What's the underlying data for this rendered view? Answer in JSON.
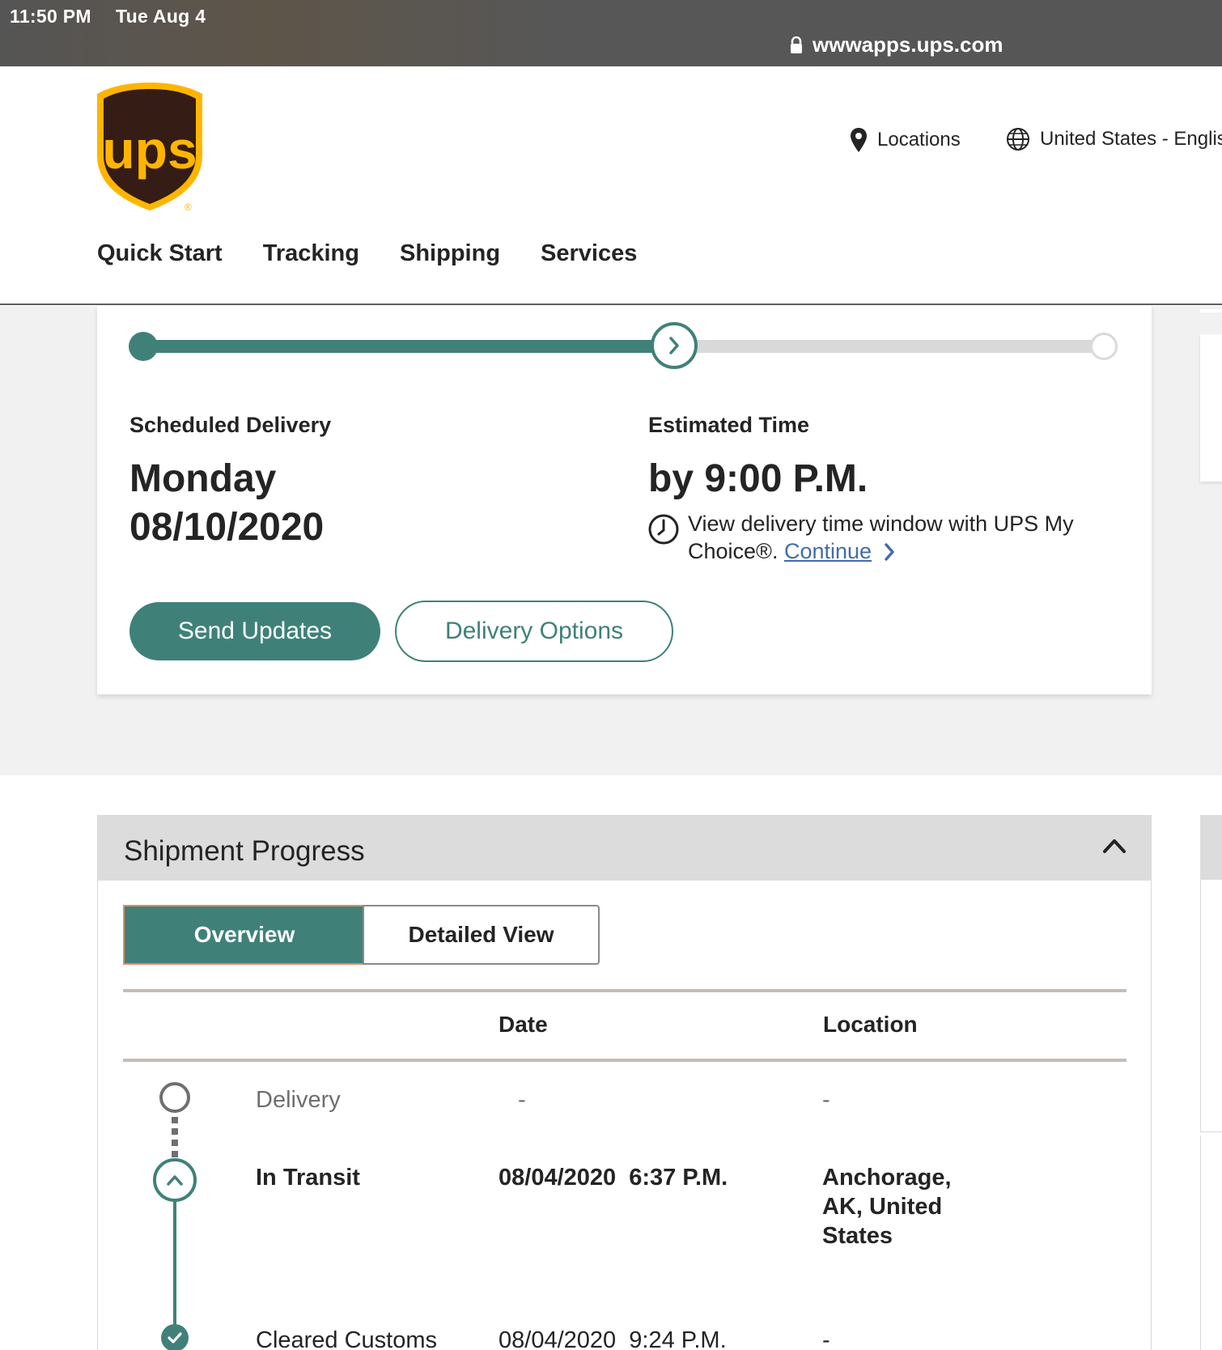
{
  "status_bar": {
    "time": "11:50 PM",
    "date": "Tue Aug 4",
    "url": "wwwapps.ups.com"
  },
  "header": {
    "logo_text": "ups",
    "locations_label": "Locations",
    "language_label": "United States - English",
    "nav": [
      "Quick Start",
      "Tracking",
      "Shipping",
      "Services"
    ]
  },
  "delivery": {
    "progress_fraction": 0.55,
    "scheduled_label": "Scheduled Delivery",
    "scheduled_day": "Monday",
    "scheduled_date": "08/10/2020",
    "estimated_label": "Estimated Time",
    "estimated_time": "by 9:00 P.M.",
    "note_text": "View delivery time window with UPS My Choice®.",
    "note_link": "Continue",
    "send_updates": "Send Updates",
    "delivery_options": "Delivery Options"
  },
  "shipment_progress": {
    "title": "Shipment Progress",
    "tabs": {
      "overview": "Overview",
      "detailed": "Detailed View"
    },
    "columns": {
      "date": "Date",
      "location": "Location"
    },
    "rows": [
      {
        "status": "Delivery",
        "date": "-",
        "location": "-"
      },
      {
        "status": "In Transit",
        "date": "08/04/2020  6:37 P.M.",
        "location": "Anchorage, AK, United States"
      },
      {
        "status": "Cleared Customs",
        "date": "08/04/2020  9:24 P.M.",
        "location": "-"
      }
    ]
  },
  "colors": {
    "accent": "#3f8179",
    "link": "#426da9",
    "ups_brown": "#351c15",
    "ups_gold": "#ffb500"
  }
}
